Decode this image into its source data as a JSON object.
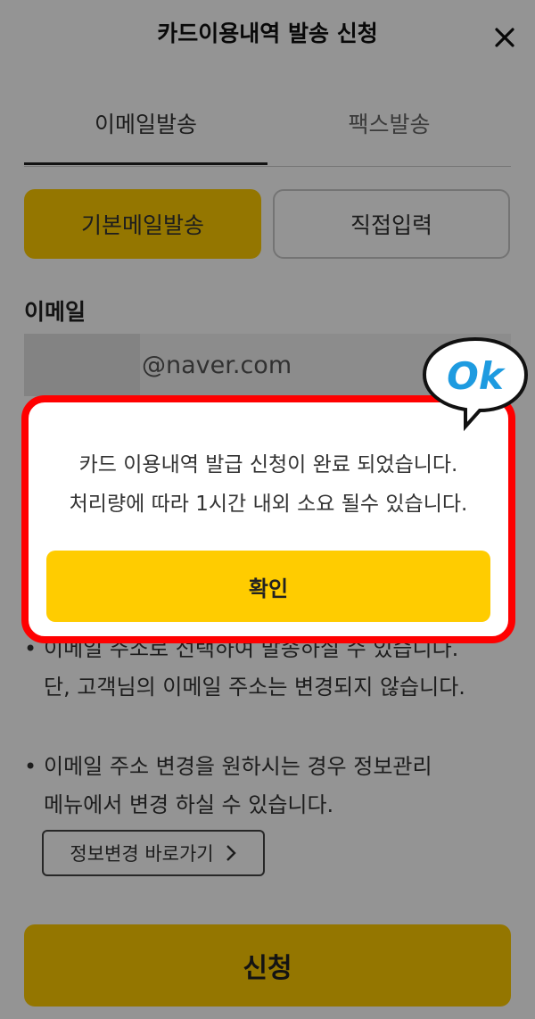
{
  "header": {
    "title": "카드이용내역 발송 신청",
    "close_icon": "close-icon"
  },
  "tabs": [
    {
      "label": "이메일발송",
      "active": true
    },
    {
      "label": "팩스발송",
      "active": false
    }
  ],
  "segment": {
    "default_label": "기본메일발송",
    "direct_label": "직접입력"
  },
  "email": {
    "label": "이메일",
    "domain": "@naver.com"
  },
  "notes": {
    "bullet1": [
      "이메일 주소로 선택하여 발송하실 수 있습니다.",
      "단, 고객님의 이메일 주소는 변경되지 않습니다."
    ],
    "bullet2": [
      "이메일 주소 변경을 원하시는 경우 정보관리",
      "메뉴에서 변경 하실 수 있습니다."
    ],
    "shortcut_label": "정보변경 바로가기"
  },
  "apply_label": "신청",
  "dialog": {
    "message_line1": "카드 이용내역 발급 신청이 완료 되었습니다.",
    "message_line2": "처리량에 따라 1시간 내외 소요 될수 있습니다.",
    "confirm_label": "확인"
  },
  "sticker": {
    "text": "Ok"
  },
  "colors": {
    "accent": "#ffcc00",
    "highlight": "#ff0000",
    "sticker_blue": "#1e9be0"
  }
}
